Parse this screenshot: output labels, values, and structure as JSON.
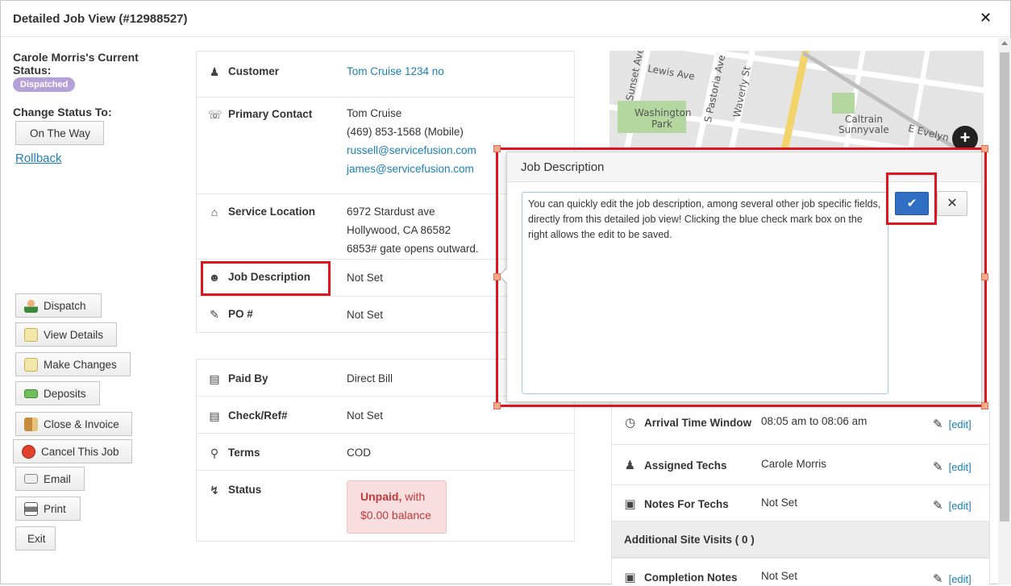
{
  "window": {
    "title": "Detailed Job View (#12988527)",
    "close_glyph": "✕"
  },
  "left": {
    "status_heading": "Carole Morris's Current Status:",
    "status_badge": "Dispatched",
    "change_status_label": "Change Status To:",
    "on_the_way": "On The Way",
    "rollback": "Rollback",
    "actions": [
      {
        "label": "Dispatch",
        "icon": "person-icon"
      },
      {
        "label": "View Details",
        "icon": "pencil-note-icon"
      },
      {
        "label": "Make Changes",
        "icon": "pencil-note-icon"
      },
      {
        "label": "Deposits",
        "icon": "money-icon"
      },
      {
        "label": "Close & Invoice",
        "icon": "door-icon"
      },
      {
        "label": "Cancel This Job",
        "icon": "stop-icon"
      },
      {
        "label": "Email",
        "icon": "envelope-icon"
      },
      {
        "label": "Print",
        "icon": "printer-icon"
      },
      {
        "label": "Exit",
        "icon": ""
      }
    ]
  },
  "details": {
    "customer": {
      "label": "Customer",
      "value": "Tom Cruise 1234 no"
    },
    "primary_contact": {
      "label": "Primary Contact",
      "name": "Tom Cruise",
      "phone": "(469) 853-1568 (Mobile)",
      "email1": "russell@servicefusion.com",
      "email2": "james@servicefusion.com"
    },
    "service_location": {
      "label": "Service Location",
      "line1": "6972 Stardust ave",
      "line2": "Hollywood, CA 86582",
      "line3": "6853# gate opens outward."
    },
    "job_description": {
      "label": "Job Description",
      "value": "Not Set"
    },
    "po": {
      "label": "PO #",
      "value": "Not Set"
    }
  },
  "payment": {
    "paid_by": {
      "label": "Paid By",
      "value": "Direct Bill"
    },
    "check_ref": {
      "label": "Check/Ref#",
      "value": "Not Set"
    },
    "terms": {
      "label": "Terms",
      "value": "COD"
    },
    "status": {
      "label": "Status",
      "unpaid": "Unpaid,",
      "with": " with",
      "balance": "$0.00 balance"
    }
  },
  "map": {
    "labels": [
      "Lewis Ave",
      "Sunset Ave",
      "S Pastoria Ave",
      "Waverly St",
      "Washington",
      "Park",
      "Caltrain",
      "Sunnyvale",
      "E Evelyn"
    ],
    "zoom_in": "+"
  },
  "schedule": {
    "arrival": {
      "label": "Arrival Time Window",
      "value": "08:05 am to 08:06 am",
      "edit": "[edit]"
    },
    "techs": {
      "label": "Assigned Techs",
      "value": "Carole Morris",
      "edit": "[edit]"
    },
    "notes": {
      "label": "Notes For Techs",
      "value": "Not Set",
      "edit": "[edit]"
    },
    "additional_visits": "Additional Site Visits ( 0 )",
    "completion": {
      "label": "Completion Notes",
      "value": "Not Set",
      "edit": "[edit]"
    }
  },
  "popup": {
    "title": "Job Description",
    "text": "You can quickly edit the job description, among several other job specific fields, directly from this detailed job view! Clicking the blue check mark box on the right allows the edit to be saved.",
    "confirm_glyph": "✔",
    "cancel_glyph": "✕"
  },
  "colors": {
    "accent": "#1a7fb5",
    "badge": "#b5a0d8",
    "annotation": "#e0141e",
    "confirm": "#2f6ec2"
  }
}
